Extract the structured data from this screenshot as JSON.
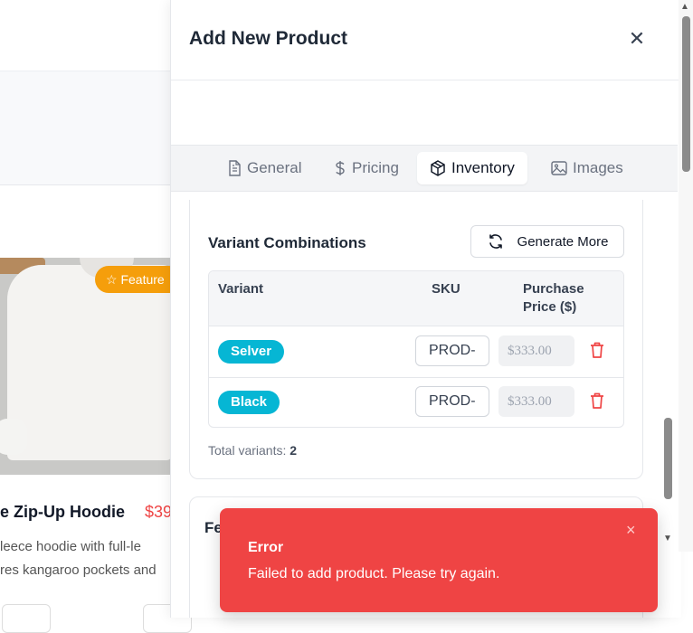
{
  "background": {
    "product_card": {
      "badge": "Feature",
      "title": "e Zip-Up Hoodie",
      "price": "$39",
      "desc_line1": "leece hoodie with full-le",
      "desc_line2": "res kangaroo pockets and"
    }
  },
  "drawer": {
    "title": "Add New Product",
    "close_icon": "close-icon",
    "tabs": [
      {
        "label": "General",
        "icon": "document-icon"
      },
      {
        "label": "Pricing",
        "icon": "dollar-icon"
      },
      {
        "label": "Inventory",
        "icon": "box-icon",
        "active": true
      },
      {
        "label": "Images",
        "icon": "image-icon"
      }
    ],
    "variants": {
      "title": "Variant Combinations",
      "generate_label": "Generate More",
      "headers": {
        "variant": "Variant",
        "sku": "SKU",
        "price_line1": "Purchase",
        "price_line2": "Price ($)"
      },
      "rows": [
        {
          "variant": "Selver",
          "sku": "PROD-",
          "price": "$333.00"
        },
        {
          "variant": "Black",
          "sku": "PROD-",
          "price": "$333.00"
        }
      ],
      "total_label": "Total variants:",
      "total_count": "2"
    },
    "next_section_title": "Fe"
  },
  "toast": {
    "title": "Error",
    "message": "Failed to add product. Please try again.",
    "close": "×"
  },
  "colors": {
    "accent_cyan": "#06b6d4",
    "error_red": "#ef4444",
    "feature_orange": "#f59e0b"
  }
}
